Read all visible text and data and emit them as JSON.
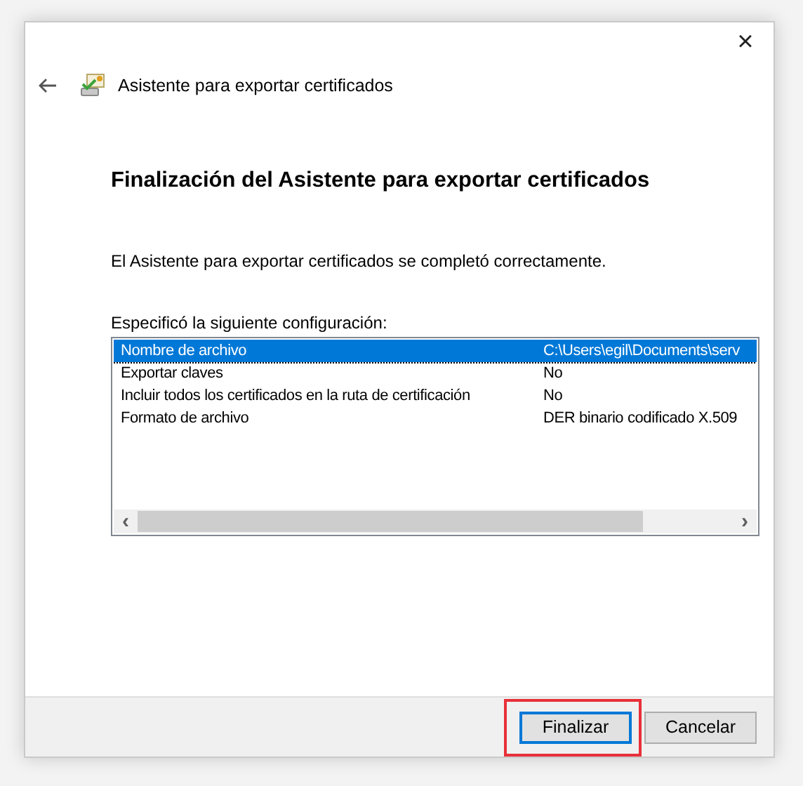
{
  "window": {
    "title": "Asistente para exportar certificados",
    "close": "×"
  },
  "heading": "Finalización del Asistente para exportar certificados",
  "message": "El Asistente para exportar certificados se completó correctamente.",
  "list_label": "Especificó la siguiente configuración:",
  "rows": [
    {
      "name": "Nombre de archivo",
      "value": "C:\\Users\\egil\\Documents\\serv",
      "selected": true
    },
    {
      "name": "Exportar claves",
      "value": "No",
      "selected": false
    },
    {
      "name": "Incluir todos los certificados en la ruta de certificación",
      "value": "No",
      "selected": false
    },
    {
      "name": "Formato de archivo",
      "value": "DER binario codificado X.509",
      "selected": false
    }
  ],
  "scrollbar": {
    "left": "‹",
    "right": "›"
  },
  "buttons": [
    {
      "label": "Finalizar",
      "default": true,
      "highlighted": true
    },
    {
      "label": "Cancelar",
      "default": false,
      "highlighted": false
    }
  ]
}
